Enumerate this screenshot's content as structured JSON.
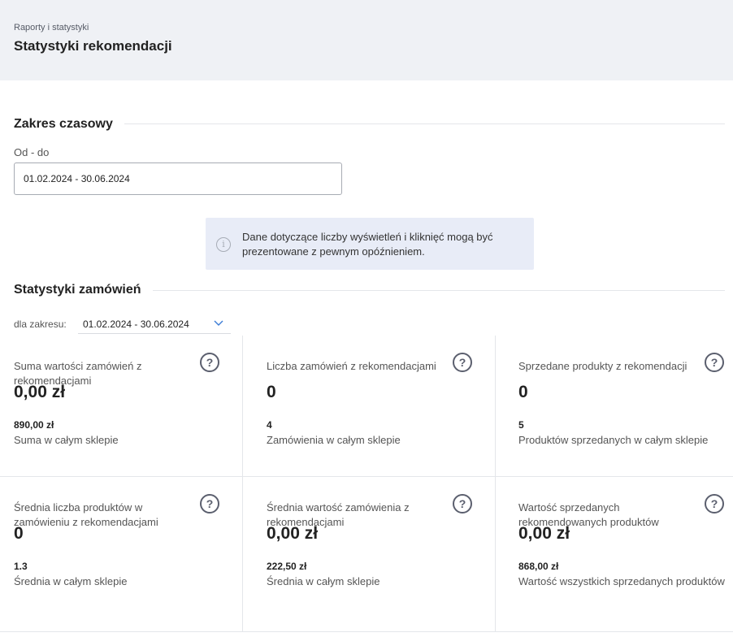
{
  "header": {
    "breadcrumb": "Raporty i statystyki",
    "title": "Statystyki rekomendacji"
  },
  "time_range": {
    "section_title": "Zakres czasowy",
    "field_label": "Od - do",
    "field_value": "01.02.2024 - 30.06.2024"
  },
  "info": {
    "icon": "info-icon",
    "text": "Dane dotyczące liczby wyświetleń i kliknięć mogą być prezentowane z pewnym opóźnieniem."
  },
  "orders": {
    "section_title": "Statystyki zamówień",
    "range_label": "dla zakresu:",
    "range_value": "01.02.2024 - 30.06.2024",
    "cards": [
      {
        "label": "Suma wartości zamówień z rekomendacjami",
        "value": "0,00 zł",
        "sub_value": "890,00 zł",
        "sub_label": "Suma w całym sklepie"
      },
      {
        "label": "Liczba zamówień z rekomendacjami",
        "value": "0",
        "sub_value": "4",
        "sub_label": "Zamówienia w całym sklepie"
      },
      {
        "label": "Sprzedane produkty z rekomendacji",
        "value": "0",
        "sub_value": "5",
        "sub_label": "Produktów sprzedanych w całym sklepie"
      },
      {
        "label": "Średnia liczba produktów w zamówieniu z rekomendacjami",
        "value": "0",
        "sub_value": "1.3",
        "sub_label": "Średnia w całym sklepie"
      },
      {
        "label": "Średnia wartość zamówienia z rekomendacjami",
        "value": "0,00 zł",
        "sub_value": "222,50 zł",
        "sub_label": "Średnia w całym sklepie"
      },
      {
        "label": "Wartość sprzedanych rekomendowanych produktów",
        "value": "0,00 zł",
        "sub_value": "868,00 zł",
        "sub_label": "Wartość wszystkich sprzedanych produktów"
      }
    ],
    "help_icon_glyph": "?"
  }
}
